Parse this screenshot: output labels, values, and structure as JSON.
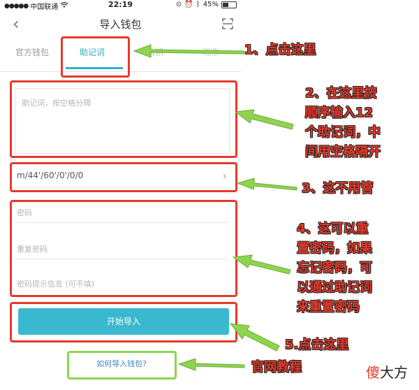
{
  "status_bar": {
    "carrier": "中国联通",
    "time": "22:19",
    "battery": "45%",
    "battery_level": 0.45
  },
  "header": {
    "title": "导入钱包",
    "back_icon": "chevron-left-icon",
    "scan_icon": "scan-icon"
  },
  "tabs": [
    {
      "label": "官方钱包",
      "active": false
    },
    {
      "label": "助记词",
      "active": true
    },
    {
      "label": "私钥",
      "active": false
    },
    {
      "label": "观察",
      "active": false
    }
  ],
  "form": {
    "mnemonic_placeholder": "助记词，按空格分隔",
    "path_value": "m/44'/60'/0'/0/0",
    "password_placeholder": "密码",
    "repeat_password_placeholder": "重复密码",
    "hint_placeholder": "密码提示信息 (可不填)",
    "import_button": "开始导入",
    "help_link": "如何导入钱包?"
  },
  "annotations": {
    "note1": "1、点击这里",
    "note2_lines": [
      "2、在这里按",
      "顺序输入12",
      "个助记词，中",
      "间用空格隔开"
    ],
    "note3": "3、这不用管",
    "note4_lines": [
      "4、这可以重",
      "置密码，如果",
      "忘记密码，可",
      "以通过助记词",
      "来重置密码"
    ],
    "note5": "5.点击这里",
    "note6": "官网教程"
  },
  "watermark": {
    "part1": "傻",
    "part2": "大方"
  },
  "colors": {
    "accent": "#3ab8cf",
    "annotation_red": "#e53a2b",
    "annotation_green": "#8fd44e"
  }
}
